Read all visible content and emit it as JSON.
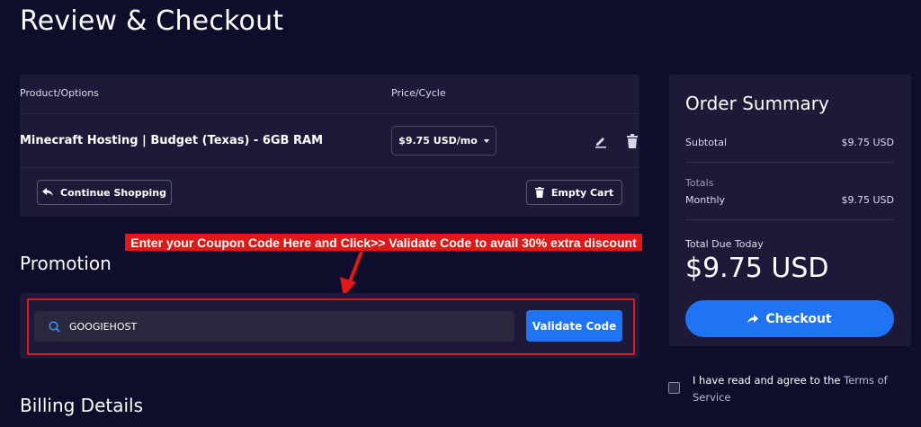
{
  "page": {
    "title": "Review & Checkout"
  },
  "cart": {
    "headers": {
      "product": "Product/Options",
      "price": "Price/Cycle"
    },
    "item": {
      "name": "Minecraft Hosting | Budget (Texas) - 6GB RAM",
      "price_cycle": "$9.75 USD/mo"
    },
    "continue_label": "Continue Shopping",
    "empty_label": "Empty Cart"
  },
  "promotion": {
    "annotation": "Enter your Coupon Code Here and Click>> Validate Code to avail 30% extra discount",
    "title": "Promotion",
    "coupon_value": "GOOGIEHOST",
    "validate_label": "Validate Code"
  },
  "billing": {
    "title": "Billing Details"
  },
  "summary": {
    "title": "Order Summary",
    "subtotal_label": "Subtotal",
    "subtotal_value": "$9.75 USD",
    "totals_label": "Totals",
    "monthly_label": "Monthly",
    "monthly_value": "$9.75 USD",
    "due_label": "Total Due Today",
    "due_value": "$9.75 USD",
    "checkout_label": "Checkout"
  },
  "terms": {
    "text": "I have read and agree to the ",
    "link": "Terms of Service"
  },
  "colors": {
    "background": "#0f0d2c",
    "panel": "#1c1a38",
    "accent": "#1e74f5",
    "annotation": "#e01818"
  },
  "icons": [
    "edit-icon",
    "trash-icon",
    "undo-arrow-icon",
    "search-icon",
    "share-arrow-icon",
    "annotation-arrow"
  ]
}
